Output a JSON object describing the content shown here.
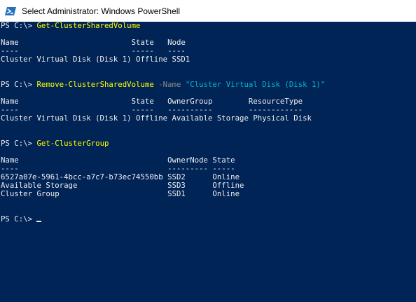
{
  "window": {
    "title": "Select Administrator: Windows PowerShell",
    "icon": "powershell-icon"
  },
  "colors": {
    "console_bg": "#012456",
    "text": "#eeedf0",
    "command": "#ffff00",
    "parameter": "#8a8a8a",
    "string": "#00b7cf"
  },
  "session": {
    "prompt": "PS C:\\> ",
    "cmd1": {
      "command": "Get-ClusterSharedVolume"
    },
    "out1": {
      "header": "Name                         State   Node",
      "divider": "----                         -----   ----",
      "row": "Cluster Virtual Disk (Disk 1) Offline SSD1"
    },
    "cmd2": {
      "command": "Remove-ClusterSharedVolume",
      "param": " -Name ",
      "value": "\"Cluster Virtual Disk (Disk 1)\""
    },
    "out2": {
      "header": "Name                         State   OwnerGroup        ResourceType",
      "divider": "----                         -----   ----------        ------------",
      "row": "Cluster Virtual Disk (Disk 1) Offline Available Storage Physical Disk"
    },
    "cmd3": {
      "command": "Get-ClusterGroup"
    },
    "out3": {
      "header": "Name                                 OwnerNode State",
      "divider": "----                                 --------- -----",
      "rows": [
        "6527a07e-5961-4bcc-a7c7-b73ec74550bb SSD2      Online",
        "Available Storage                    SSD3      Offline",
        "Cluster Group                        SSD1      Online"
      ]
    }
  }
}
